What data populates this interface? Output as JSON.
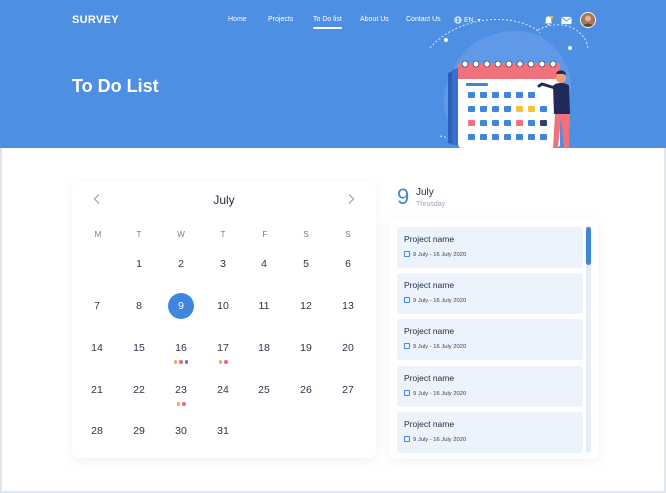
{
  "header": {
    "brand": "SURVEY",
    "nav": [
      "Home",
      "Projects",
      "To Do list",
      "About Us",
      "Contact Us"
    ],
    "active_nav": "To Do list",
    "language": "EN",
    "title": "To Do List",
    "colors": {
      "hero": "#4d8fe3",
      "accent": "#3f86de"
    }
  },
  "calendar": {
    "month": "July",
    "weekdays": [
      "M",
      "T",
      "W",
      "T",
      "F",
      "S",
      "S"
    ],
    "days": [
      [
        "",
        "1",
        "2",
        "3",
        "4",
        "5",
        "6"
      ],
      [
        "7",
        "8",
        "9",
        "10",
        "11",
        "12",
        "13"
      ],
      [
        "14",
        "15",
        "16",
        "17",
        "18",
        "19",
        "20"
      ],
      [
        "21",
        "22",
        "23",
        "24",
        "25",
        "26",
        "27"
      ],
      [
        "28",
        "29",
        "30",
        "31",
        "",
        "",
        ""
      ]
    ],
    "selected_day": "9",
    "event_dots": {
      "16": [
        "#f2a85c",
        "#ef6b7a",
        "#3f86de"
      ],
      "17": [
        "#f2a85c",
        "#ef6b7a"
      ],
      "23": [
        "#f2a85c",
        "#ef6b7a"
      ]
    }
  },
  "day_detail": {
    "day_number": "9",
    "month": "July",
    "weekday": "Thrusday",
    "tasks": [
      {
        "name": "Project name",
        "date": "9 July - 16 July 2020"
      },
      {
        "name": "Project name",
        "date": "9 July - 16 July 2020"
      },
      {
        "name": "Project name",
        "date": "9 July - 16 July 2020"
      },
      {
        "name": "Project name",
        "date": "9 July - 16 July 2020"
      },
      {
        "name": "Project name",
        "date": "9 July - 16 July 2020"
      }
    ]
  }
}
